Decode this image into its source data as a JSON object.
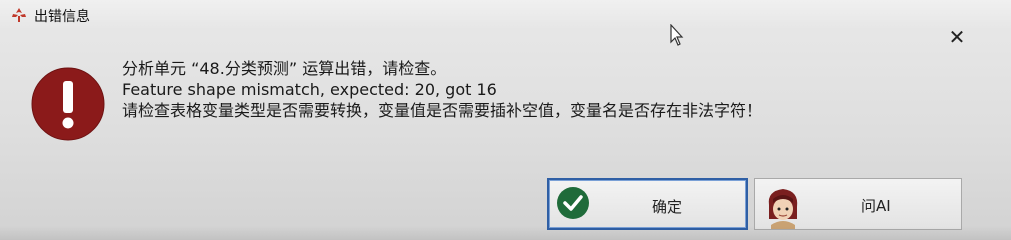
{
  "window": {
    "title": "出错信息",
    "title_icon": "app-logo-icon",
    "close_glyph": "✕"
  },
  "message": {
    "line1": "分析单元 “48.分类预测” 运算出错，请检查。",
    "line2": "Feature shape mismatch, expected: 20, got 16",
    "line3": "请检查表格变量类型是否需要转换，变量值是否需要插补空值，变量名是否存在非法字符！",
    "icon": "error-exclamation-icon",
    "icon_color": "#8b1a1a"
  },
  "buttons": {
    "ok_label": "确定",
    "ok_icon": "checkmark-icon",
    "ok_icon_color": "#1f6b3a",
    "ask_label": "问AI",
    "ask_icon": "assistant-avatar-icon"
  },
  "colors": {
    "accent": "#2f5fa5",
    "background": "#dedede"
  }
}
